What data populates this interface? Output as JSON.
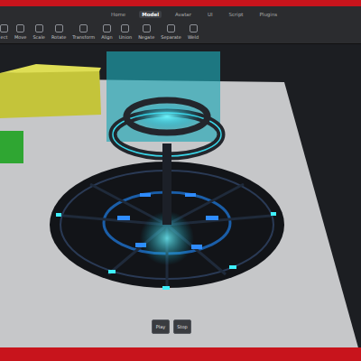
{
  "tabs": [
    {
      "label": "Home",
      "selected": false
    },
    {
      "label": "Model",
      "selected": true
    },
    {
      "label": "Avatar",
      "selected": false
    },
    {
      "label": "UI",
      "selected": false
    },
    {
      "label": "Script",
      "selected": false
    },
    {
      "label": "Plugins",
      "selected": false
    }
  ],
  "tools": [
    "ect",
    "Move",
    "Scale",
    "Rotate",
    "Transform",
    "Align",
    "Union",
    "Negate",
    "Separate",
    "Weld"
  ],
  "viewport_buttons": [
    "Play",
    "Stop"
  ]
}
